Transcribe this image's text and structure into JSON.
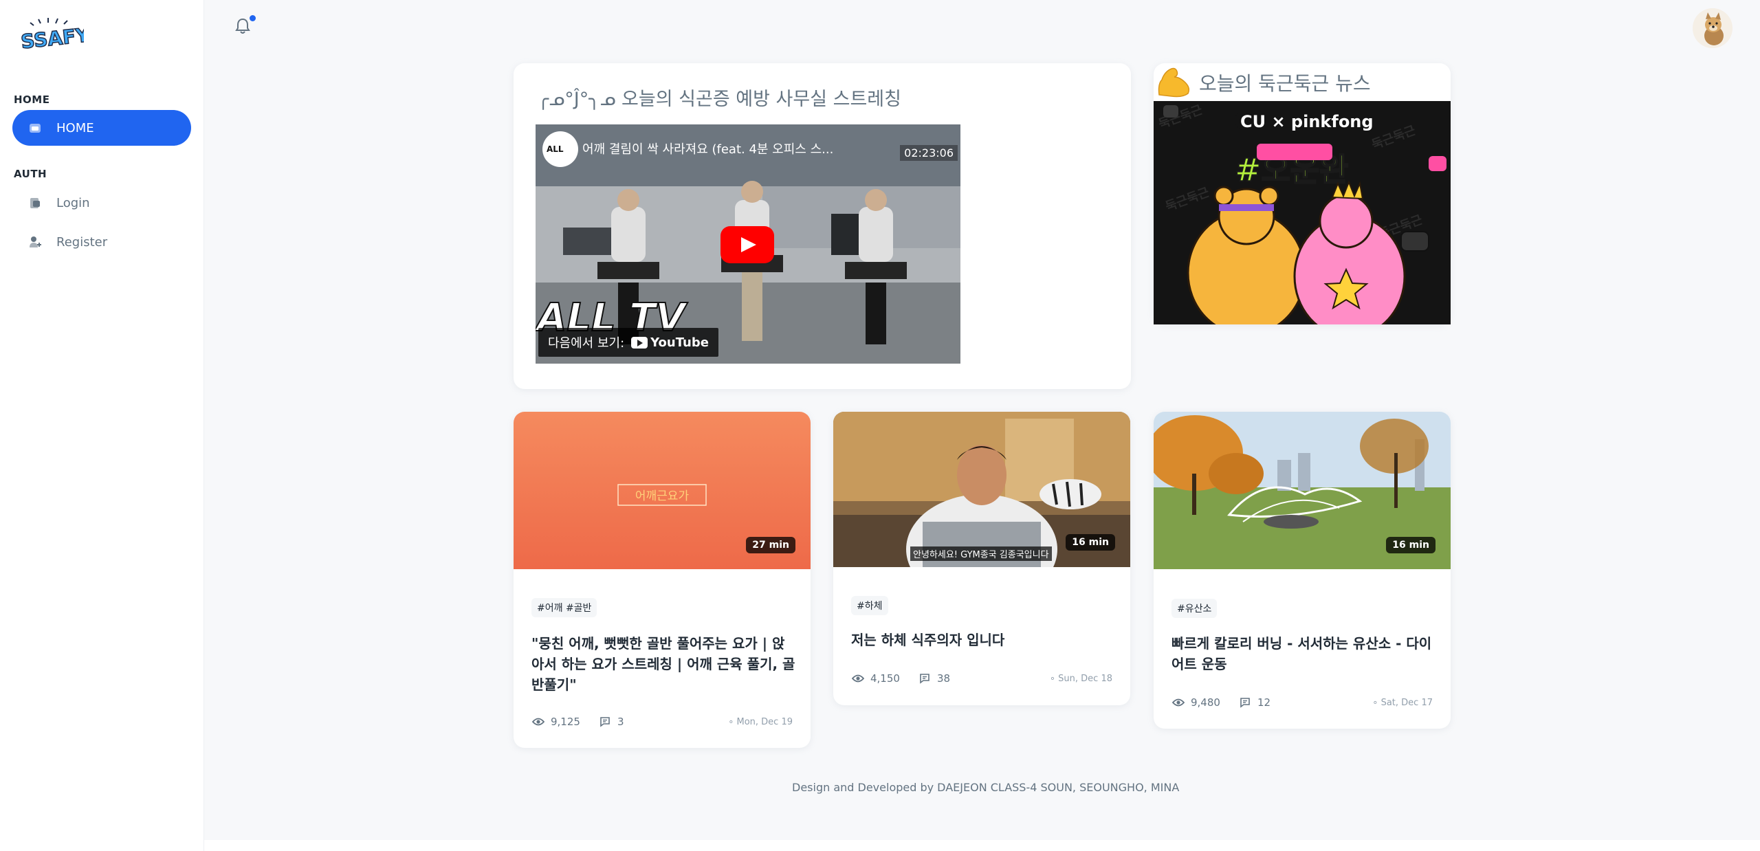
{
  "sidebar": {
    "logo_text": "SSAFY",
    "section_home": "HOME",
    "item_home": "HOME",
    "section_auth": "AUTH",
    "item_login": "Login",
    "item_register": "Register"
  },
  "header": {
    "bell_icon": "bell-icon",
    "avatar_icon": "dog-avatar"
  },
  "stretch_card": {
    "title": "╭ᓄ°Ĵ°╮ᓄ 오늘의 식곤증 예방 사무실 스트레칭",
    "video_title": "어깨 결림이 싹 사라져요 (feat. 4분 오피스 스...",
    "video_time": "02:23:06",
    "watch_on": "다음에서 보기:",
    "youtube": "YouTube"
  },
  "news_card": {
    "title": "오늘의 둑근둑근 뉴스"
  },
  "posts": [
    {
      "duration": "27 min",
      "tags": "#어깨 #골반",
      "title": "\"뭉친 어깨, 뻣뻣한 골반 풀어주는 요가 | 앉아서 하는 요가 스트레칭 | 어깨 근육 풀기, 골반풀기\"",
      "views": "9,125",
      "comments": "3",
      "date": "Mon, Dec 19",
      "thumb_caption": "어깨근요가"
    },
    {
      "duration": "16 min",
      "tags": "#하체",
      "title": "저는 하체 식주의자 입니다",
      "views": "4,150",
      "comments": "38",
      "date": "Sun, Dec 18",
      "thumb_caption": "안녕하세요! GYM종국 김종국입니다"
    },
    {
      "duration": "16 min",
      "tags": "#유산소",
      "title": "빠르게 칼로리 버닝 - 서서하는 유산소 - 다이어트 운동",
      "views": "9,480",
      "comments": "12",
      "date": "Sat, Dec 17"
    }
  ],
  "footer": {
    "text": "Design and Developed by DAEJEON CLASS-4 SOUN, SEOUNGHO, MINA"
  },
  "colors": {
    "accent": "#2065f0",
    "background": "#f7f8fa"
  }
}
